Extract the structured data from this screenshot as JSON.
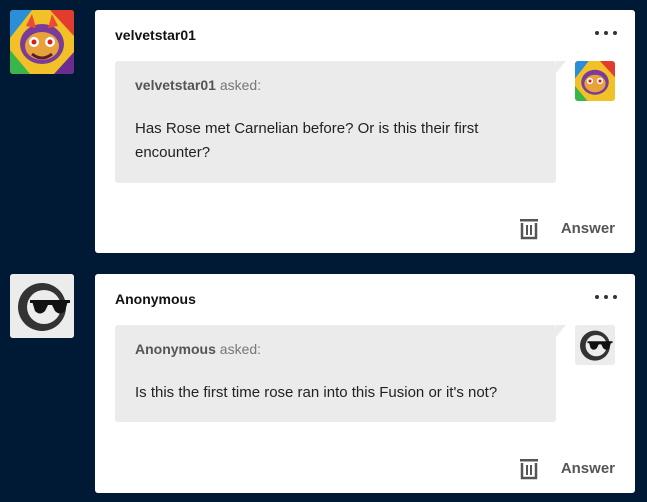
{
  "posts": [
    {
      "username": "velvetstar01",
      "asker": "velvetstar01",
      "asked_label": "asked:",
      "question": "Has Rose met Carnelian before? Or is this their first encounter?",
      "answer_label": "Answer",
      "avatar_icon": "mask-art-icon"
    },
    {
      "username": "Anonymous",
      "asker": "Anonymous",
      "asked_label": "asked:",
      "question": "Is this the first time rose ran into this Fusion or it's not?",
      "answer_label": "Answer",
      "avatar_icon": "sunglasses-ghost-icon"
    }
  ],
  "colors": {
    "background": "#001935",
    "card": "#ffffff",
    "bubble": "#ebebeb"
  }
}
